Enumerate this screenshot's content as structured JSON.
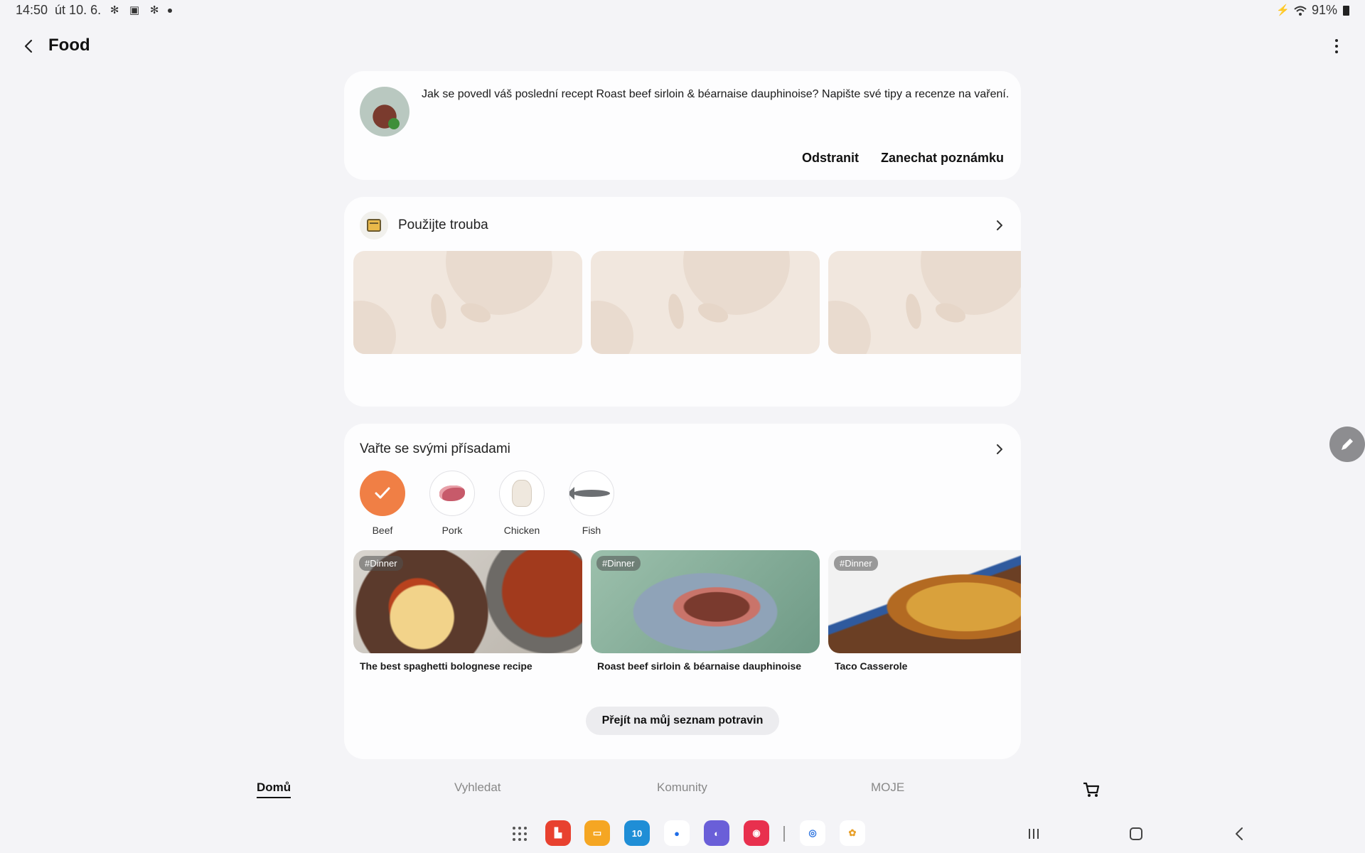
{
  "status_bar": {
    "time": "14:50",
    "date": "út 10. 6.",
    "battery": "91%",
    "icons_left": [
      "pinwheel-icon",
      "gallery-icon",
      "pinwheel-icon",
      "dot-icon"
    ],
    "icons_right": [
      "mute-icon",
      "wifi-icon",
      "battery-icon"
    ]
  },
  "app_bar": {
    "title": "Food"
  },
  "review_card": {
    "text": "Jak se povedl váš poslední recept Roast beef sirloin & béarnaise dauphinoise? Napište své tipy a recenze na vaření.",
    "delete_label": "Odstranit",
    "note_label": "Zanechat poznámku"
  },
  "oven_section": {
    "title": "Použijte trouba"
  },
  "ingredients_section": {
    "title": "Vařte se svými přísadami",
    "ingredients": [
      {
        "label": "Beef",
        "selected": true
      },
      {
        "label": "Pork",
        "selected": false
      },
      {
        "label": "Chicken",
        "selected": false
      },
      {
        "label": "Fish",
        "selected": false
      }
    ],
    "recipes": [
      {
        "tag": "#Dinner",
        "title": "The best spaghetti bolognese recipe"
      },
      {
        "tag": "#Dinner",
        "title": "Roast beef sirloin & béarnaise dauphinoise"
      },
      {
        "tag": "#Dinner",
        "title": "Taco Casserole"
      }
    ],
    "grocery_button": "Přejít na můj seznam potravin"
  },
  "bottom_nav": {
    "home": "Domů",
    "search": "Vyhledat",
    "communities": "Komunity",
    "mine": "MOJE"
  },
  "colors": {
    "accent": "#f07f45",
    "background": "#f4f4f7",
    "card": "#fdfdfe"
  }
}
